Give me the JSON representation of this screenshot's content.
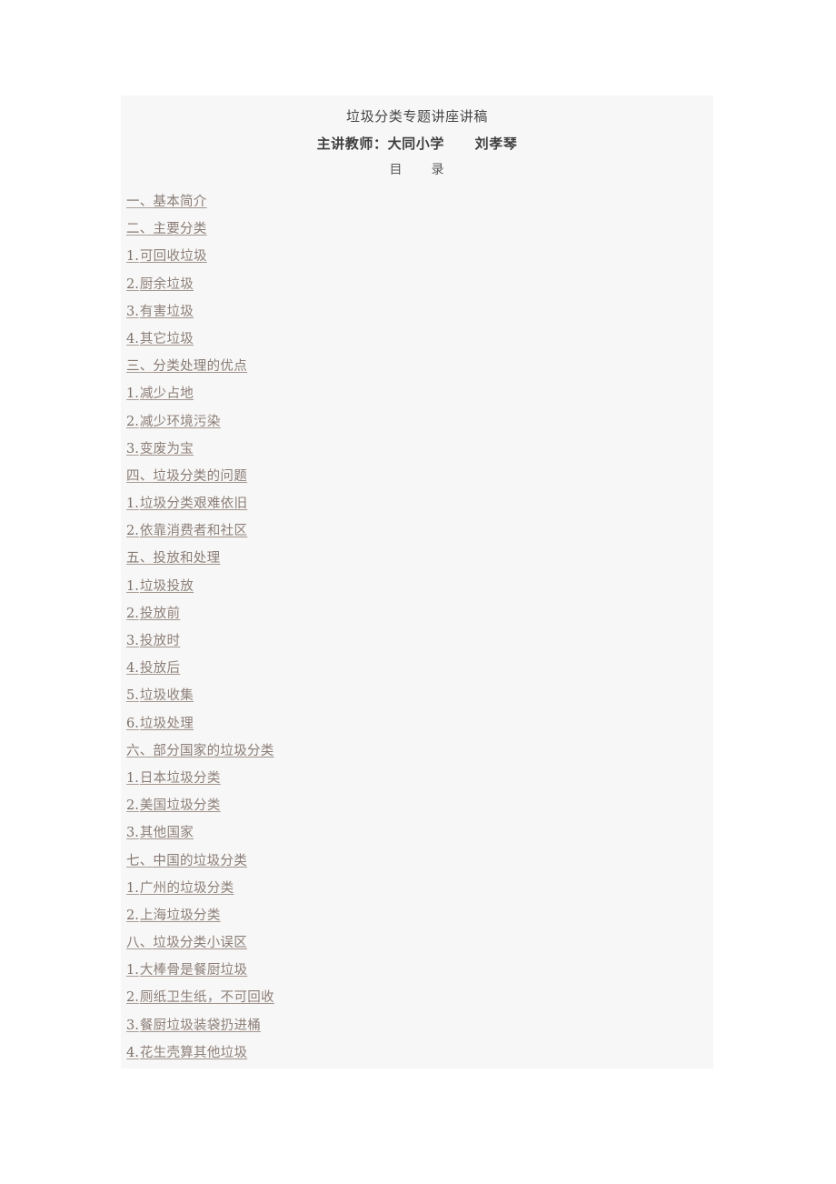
{
  "document": {
    "title": "垃圾分类专题讲座讲稿",
    "presenter_line": "主讲教师：大同小学",
    "presenter_name": "刘孝琴",
    "toc_heading_left": "目",
    "toc_heading_right": "录"
  },
  "colors": {
    "page_background": "#f7f7f7",
    "canvas_background": "#ffffff",
    "link_text": "#8d7f78",
    "number_text": "#7c7068",
    "heading_text": "#464646"
  },
  "toc": {
    "items": [
      {
        "num": "一、",
        "label": "基本简介",
        "level": 1
      },
      {
        "num": "二、",
        "label": "主要分类",
        "level": 1
      },
      {
        "num": "1.",
        "label": "可回收垃圾",
        "level": 2
      },
      {
        "num": "2.",
        "label": "厨余垃圾",
        "level": 2
      },
      {
        "num": "3.",
        "label": "有害垃圾",
        "level": 2
      },
      {
        "num": "4.",
        "label": "其它垃圾",
        "level": 2
      },
      {
        "num": "三、",
        "label": "分类处理的优点",
        "level": 1
      },
      {
        "num": "1.",
        "label": "减少占地",
        "level": 2
      },
      {
        "num": "2.",
        "label": "减少环境污染",
        "level": 2
      },
      {
        "num": "3.",
        "label": "变废为宝",
        "level": 2
      },
      {
        "num": "四、",
        "label": "垃圾分类的问题",
        "level": 1
      },
      {
        "num": "1.",
        "label": "垃圾分类艰难依旧",
        "level": 2
      },
      {
        "num": "2.",
        "label": "依靠消费者和社区",
        "level": 2
      },
      {
        "num": "五、",
        "label": "投放和处理",
        "level": 1
      },
      {
        "num": "1.",
        "label": "垃圾投放",
        "level": 2
      },
      {
        "num": "2.",
        "label": "投放前",
        "level": 2
      },
      {
        "num": "3.",
        "label": "投放时",
        "level": 2
      },
      {
        "num": "4.",
        "label": "投放后",
        "level": 2
      },
      {
        "num": "5.",
        "label": "垃圾收集",
        "level": 2
      },
      {
        "num": "6.",
        "label": "垃圾处理",
        "level": 2
      },
      {
        "num": "六、",
        "label": "部分国家的垃圾分类",
        "level": 1
      },
      {
        "num": "1.",
        "label": "日本垃圾分类",
        "level": 2
      },
      {
        "num": "2.",
        "label": "美国垃圾分类",
        "level": 2
      },
      {
        "num": "3.",
        "label": "其他国家",
        "level": 2
      },
      {
        "num": "七、",
        "label": "中国的垃圾分类",
        "level": 1
      },
      {
        "num": "1.",
        "label": "广州的垃圾分类",
        "level": 2
      },
      {
        "num": "2.",
        "label": "上海垃圾分类",
        "level": 2
      },
      {
        "num": "八、",
        "label": "垃圾分类小误区",
        "level": 1
      },
      {
        "num": "1.",
        "label": "大棒骨是餐厨垃圾",
        "level": 2
      },
      {
        "num": "2.",
        "label": "厕纸卫生纸，不可回收",
        "level": 2
      },
      {
        "num": "3.",
        "label": "餐厨垃圾装袋扔进桶",
        "level": 2
      },
      {
        "num": "4.",
        "label": "花生壳算其他垃圾",
        "level": 2
      }
    ]
  }
}
